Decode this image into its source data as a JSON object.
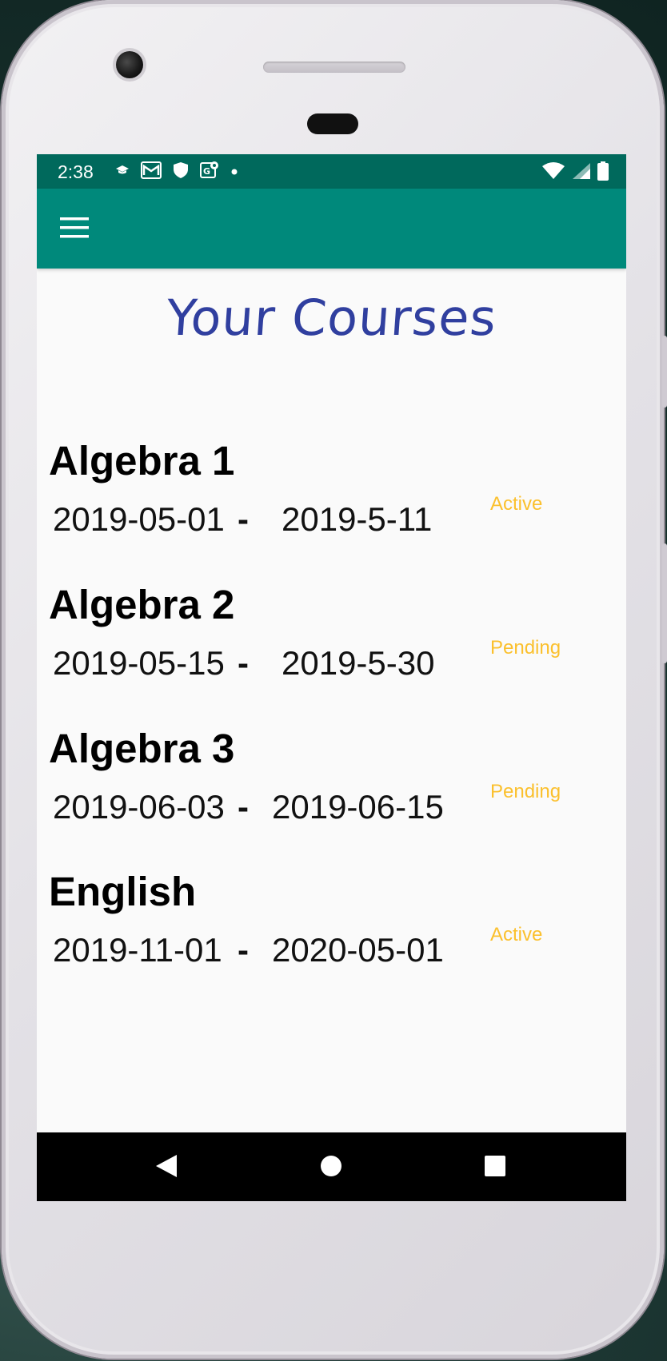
{
  "status_bar": {
    "time": "2:38",
    "left_icons": [
      "graduation-cap-icon",
      "gmail-icon",
      "shield-icon",
      "maps-icon",
      "dot-icon"
    ],
    "right_icons": [
      "wifi-icon",
      "signal-icon",
      "battery-icon"
    ]
  },
  "app_bar": {
    "menu_icon": "hamburger-menu-icon",
    "color": "#00897b",
    "status_color": "#00695c"
  },
  "page": {
    "title": "Your Courses",
    "title_color": "#303f9f"
  },
  "courses": [
    {
      "name": "Algebra 1",
      "start": "2019-05-01",
      "separator": "-",
      "end": "2019-5-11",
      "status": "Active"
    },
    {
      "name": "Algebra 2",
      "start": "2019-05-15",
      "separator": "-",
      "end": "2019-5-30",
      "status": "Pending"
    },
    {
      "name": "Algebra 3",
      "start": "2019-06-03",
      "separator": "-",
      "end": "2019-06-15",
      "status": "Pending"
    },
    {
      "name": "English",
      "start": "2019-11-01",
      "separator": "-",
      "end": "2020-05-01",
      "status": "Active"
    }
  ],
  "status_color": "#fbc02d",
  "nav_bar": {
    "buttons": [
      "back-icon",
      "home-icon",
      "recents-icon"
    ]
  }
}
